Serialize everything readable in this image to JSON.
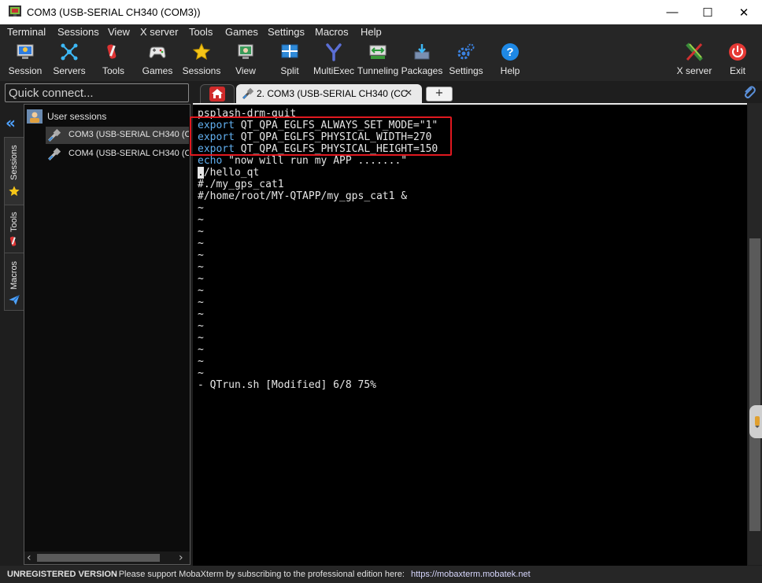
{
  "window": {
    "title": "COM3  (USB-SERIAL CH340 (COM3))"
  },
  "controls": {
    "minimize": "—",
    "maximize": "☐",
    "close": "✕"
  },
  "menu": [
    "Terminal",
    "Sessions",
    "View",
    "X server",
    "Tools",
    "Games",
    "Settings",
    "Macros",
    "Help"
  ],
  "toolbar": {
    "session": "Session",
    "servers": "Servers",
    "tools": "Tools",
    "games": "Games",
    "sessions": "Sessions",
    "view": "View",
    "split": "Split",
    "multiexec": "MultiExec",
    "tunneling": "Tunneling",
    "packages": "Packages",
    "settings": "Settings",
    "help": "Help",
    "xserver": "X server",
    "exit": "Exit"
  },
  "quick_connect": {
    "placeholder": "Quick connect..."
  },
  "tabs": {
    "active_label": "2. COM3  (USB-SERIAL CH340 (CC",
    "close": "✕",
    "add": "+"
  },
  "sidebar": {
    "collapse": "«",
    "vertical_tabs": {
      "sessions": "Sessions",
      "tools": "Tools",
      "macros": "Macros"
    },
    "header": "User sessions",
    "items": [
      {
        "label": "COM3  (USB-SERIAL CH340 (CC"
      },
      {
        "label": "COM4  (USB-SERIAL CH340 (CC"
      }
    ],
    "scroll_left": "‹",
    "scroll_right": "›"
  },
  "terminal": {
    "lines": {
      "l1": "psplash-drm-quit",
      "l2_kw": "export",
      "l2": " QT_QPA_EGLFS_ALWAYS_SET_MODE=\"1\"",
      "l3_kw": "export",
      "l3": " QT_QPA_EGLFS_PHYSICAL_WIDTH=270",
      "l4_kw": "export",
      "l4": " QT_QPA_EGLFS_PHYSICAL_HEIGHT=150",
      "l5_kw": "echo",
      "l5": " \"now will run my APP .......\"",
      "l6_cursor": ".",
      "l6": "/hello_qt",
      "l7": "#./my_gps_cat1",
      "l8": "#/home/root/MY-QTAPP/my_gps_cat1 &",
      "tilde": "~",
      "status": "- QTrun.sh [Modified] 6/8 75%"
    }
  },
  "statusbar": {
    "unregistered": "UNREGISTERED VERSION",
    "message": "  -  Please support MobaXterm by subscribing to the professional edition here:",
    "link": "https://mobaxterm.mobatek.net"
  },
  "colors": {
    "highlight_box": "#e0181f",
    "keyword": "#61afef",
    "background": "#000000"
  }
}
